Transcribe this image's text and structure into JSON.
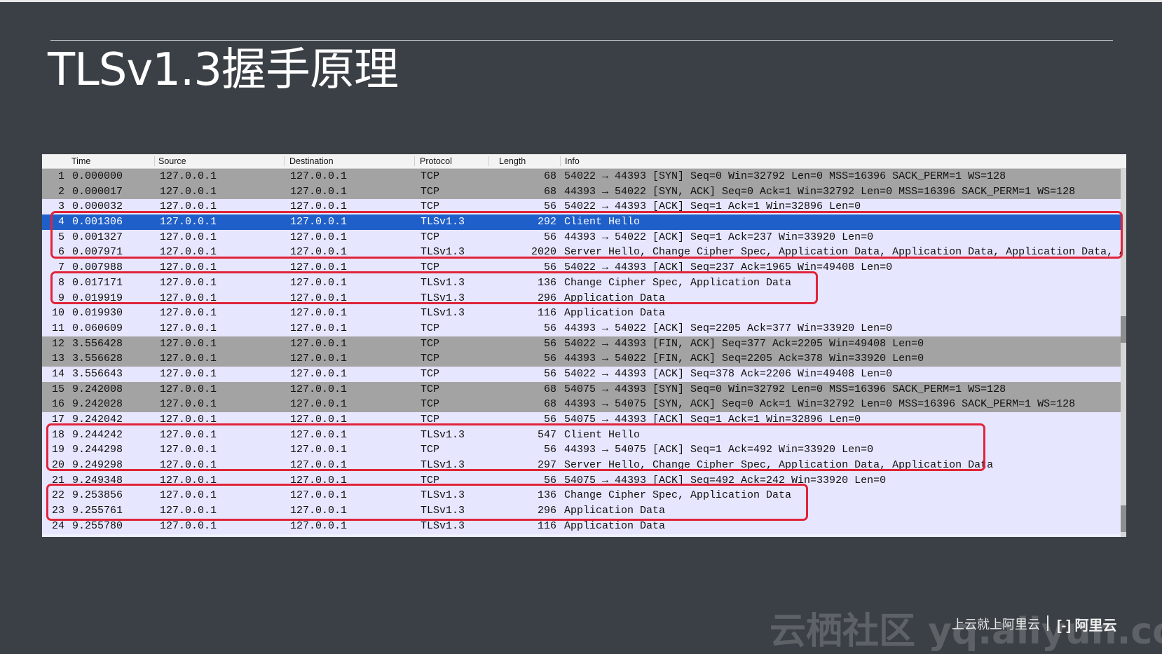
{
  "slide": {
    "title": "TLSv1.3握手原理"
  },
  "table": {
    "columns": [
      "Time",
      "Source",
      "Destination",
      "Protocol",
      "Length",
      "Info"
    ],
    "rows": [
      {
        "no": "1",
        "time": "0.000000",
        "src": "127.0.0.1",
        "dst": "127.0.0.1",
        "proto": "TCP",
        "len": "68",
        "info": "54022 → 44393 [SYN] Seq=0 Win=32792 Len=0 MSS=16396 SACK_PERM=1 WS=128",
        "style": "flag"
      },
      {
        "no": "2",
        "time": "0.000017",
        "src": "127.0.0.1",
        "dst": "127.0.0.1",
        "proto": "TCP",
        "len": "68",
        "info": "44393 → 54022 [SYN, ACK] Seq=0 Ack=1 Win=32792 Len=0 MSS=16396 SACK_PERM=1 WS=128",
        "style": "flag"
      },
      {
        "no": "3",
        "time": "0.000032",
        "src": "127.0.0.1",
        "dst": "127.0.0.1",
        "proto": "TCP",
        "len": "56",
        "info": "54022 → 44393 [ACK] Seq=1 Ack=1 Win=32896 Len=0",
        "style": "tcp"
      },
      {
        "no": "4",
        "time": "0.001306",
        "src": "127.0.0.1",
        "dst": "127.0.0.1",
        "proto": "TLSv1.3",
        "len": "292",
        "info": "Client Hello",
        "style": "sel"
      },
      {
        "no": "5",
        "time": "0.001327",
        "src": "127.0.0.1",
        "dst": "127.0.0.1",
        "proto": "TCP",
        "len": "56",
        "info": "44393 → 54022 [ACK] Seq=1 Ack=237 Win=33920 Len=0",
        "style": "tcp"
      },
      {
        "no": "6",
        "time": "0.007971",
        "src": "127.0.0.1",
        "dst": "127.0.0.1",
        "proto": "TLSv1.3",
        "len": "2020",
        "info": "Server Hello, Change Cipher Spec, Application Data, Application Data, Application Data, Applic",
        "style": "tls"
      },
      {
        "no": "7",
        "time": "0.007988",
        "src": "127.0.0.1",
        "dst": "127.0.0.1",
        "proto": "TCP",
        "len": "56",
        "info": "54022 → 44393 [ACK] Seq=237 Ack=1965 Win=49408 Len=0",
        "style": "tcp"
      },
      {
        "no": "8",
        "time": "0.017171",
        "src": "127.0.0.1",
        "dst": "127.0.0.1",
        "proto": "TLSv1.3",
        "len": "136",
        "info": "Change Cipher Spec, Application Data",
        "style": "tls"
      },
      {
        "no": "9",
        "time": "0.019919",
        "src": "127.0.0.1",
        "dst": "127.0.0.1",
        "proto": "TLSv1.3",
        "len": "296",
        "info": "Application Data",
        "style": "tls"
      },
      {
        "no": "10",
        "time": "0.019930",
        "src": "127.0.0.1",
        "dst": "127.0.0.1",
        "proto": "TLSv1.3",
        "len": "116",
        "info": "Application Data",
        "style": "tls"
      },
      {
        "no": "11",
        "time": "0.060609",
        "src": "127.0.0.1",
        "dst": "127.0.0.1",
        "proto": "TCP",
        "len": "56",
        "info": "44393 → 54022 [ACK] Seq=2205 Ack=377 Win=33920 Len=0",
        "style": "tcp"
      },
      {
        "no": "12",
        "time": "3.556428",
        "src": "127.0.0.1",
        "dst": "127.0.0.1",
        "proto": "TCP",
        "len": "56",
        "info": "54022 → 44393 [FIN, ACK] Seq=377 Ack=2205 Win=49408 Len=0",
        "style": "flag"
      },
      {
        "no": "13",
        "time": "3.556628",
        "src": "127.0.0.1",
        "dst": "127.0.0.1",
        "proto": "TCP",
        "len": "56",
        "info": "44393 → 54022 [FIN, ACK] Seq=2205 Ack=378 Win=33920 Len=0",
        "style": "flag"
      },
      {
        "no": "14",
        "time": "3.556643",
        "src": "127.0.0.1",
        "dst": "127.0.0.1",
        "proto": "TCP",
        "len": "56",
        "info": "54022 → 44393 [ACK] Seq=378 Ack=2206 Win=49408 Len=0",
        "style": "tcp"
      },
      {
        "no": "15",
        "time": "9.242008",
        "src": "127.0.0.1",
        "dst": "127.0.0.1",
        "proto": "TCP",
        "len": "68",
        "info": "54075 → 44393 [SYN] Seq=0 Win=32792 Len=0 MSS=16396 SACK_PERM=1 WS=128",
        "style": "flag"
      },
      {
        "no": "16",
        "time": "9.242028",
        "src": "127.0.0.1",
        "dst": "127.0.0.1",
        "proto": "TCP",
        "len": "68",
        "info": "44393 → 54075 [SYN, ACK] Seq=0 Ack=1 Win=32792 Len=0 MSS=16396 SACK_PERM=1 WS=128",
        "style": "flag"
      },
      {
        "no": "17",
        "time": "9.242042",
        "src": "127.0.0.1",
        "dst": "127.0.0.1",
        "proto": "TCP",
        "len": "56",
        "info": "54075 → 44393 [ACK] Seq=1 Ack=1 Win=32896 Len=0",
        "style": "tcp"
      },
      {
        "no": "18",
        "time": "9.244242",
        "src": "127.0.0.1",
        "dst": "127.0.0.1",
        "proto": "TLSv1.3",
        "len": "547",
        "info": "Client Hello",
        "style": "tls"
      },
      {
        "no": "19",
        "time": "9.244298",
        "src": "127.0.0.1",
        "dst": "127.0.0.1",
        "proto": "TCP",
        "len": "56",
        "info": "44393 → 54075 [ACK] Seq=1 Ack=492 Win=33920 Len=0",
        "style": "tcp"
      },
      {
        "no": "20",
        "time": "9.249298",
        "src": "127.0.0.1",
        "dst": "127.0.0.1",
        "proto": "TLSv1.3",
        "len": "297",
        "info": "Server Hello, Change Cipher Spec, Application Data, Application Data",
        "style": "tls"
      },
      {
        "no": "21",
        "time": "9.249348",
        "src": "127.0.0.1",
        "dst": "127.0.0.1",
        "proto": "TCP",
        "len": "56",
        "info": "54075 → 44393 [ACK] Seq=492 Ack=242 Win=33920 Len=0",
        "style": "tcp"
      },
      {
        "no": "22",
        "time": "9.253856",
        "src": "127.0.0.1",
        "dst": "127.0.0.1",
        "proto": "TLSv1.3",
        "len": "136",
        "info": "Change Cipher Spec, Application Data",
        "style": "tls"
      },
      {
        "no": "23",
        "time": "9.255761",
        "src": "127.0.0.1",
        "dst": "127.0.0.1",
        "proto": "TLSv1.3",
        "len": "296",
        "info": "Application Data",
        "style": "tls"
      },
      {
        "no": "24",
        "time": "9.255780",
        "src": "127.0.0.1",
        "dst": "127.0.0.1",
        "proto": "TLSv1.3",
        "len": "116",
        "info": "Application Data",
        "style": "tls"
      }
    ],
    "highlight_color": "#e0243a",
    "selected_row_color": "#1f5fc9"
  },
  "footer": {
    "watermark": "云栖社区 yq.aliyun.com",
    "tagline": "上云就上阿里云",
    "logo_icon": "aliyun-logo-icon",
    "logo_text": "阿里云"
  }
}
